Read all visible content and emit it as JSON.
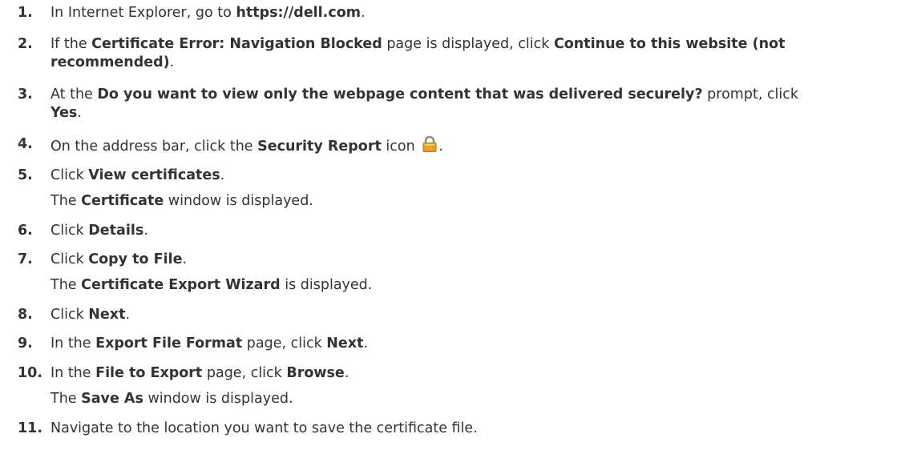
{
  "steps": [
    {
      "num": "1.",
      "parts": [
        {
          "t": "In Internet Explorer, go to ",
          "b": false
        },
        {
          "t": "https://dell.com",
          "b": true
        },
        {
          "t": ".",
          "b": false
        }
      ]
    },
    {
      "num": "2.",
      "parts": [
        {
          "t": "If the ",
          "b": false
        },
        {
          "t": "Certificate Error: Navigation Blocked",
          "b": true
        },
        {
          "t": " page is displayed, click ",
          "b": false
        },
        {
          "t": "Continue to this website (not",
          "b": true
        }
      ],
      "parts2": [
        {
          "t": "recommended)",
          "b": true
        },
        {
          "t": ".",
          "b": false
        }
      ]
    },
    {
      "num": "3.",
      "parts": [
        {
          "t": "At the ",
          "b": false
        },
        {
          "t": "Do you want to view only the webpage content that was delivered securely?",
          "b": true
        },
        {
          "t": " prompt, click",
          "b": false
        }
      ],
      "parts2": [
        {
          "t": "Yes",
          "b": true
        },
        {
          "t": ".",
          "b": false
        }
      ]
    },
    {
      "num": "4.",
      "parts": [
        {
          "t": "On the address bar, click the ",
          "b": false
        },
        {
          "t": "Security Report",
          "b": true
        },
        {
          "t": " icon ",
          "b": false
        }
      ],
      "after_icon": "."
    },
    {
      "num": "5.",
      "parts": [
        {
          "t": "Click ",
          "b": false
        },
        {
          "t": "View certificates",
          "b": true
        },
        {
          "t": ".",
          "b": false
        }
      ],
      "result": [
        {
          "t": "The ",
          "b": false
        },
        {
          "t": "Certificate",
          "b": true
        },
        {
          "t": " window is displayed.",
          "b": false
        }
      ]
    },
    {
      "num": "6.",
      "parts": [
        {
          "t": "Click ",
          "b": false
        },
        {
          "t": "Details",
          "b": true
        },
        {
          "t": ".",
          "b": false
        }
      ]
    },
    {
      "num": "7.",
      "parts": [
        {
          "t": "Click ",
          "b": false
        },
        {
          "t": "Copy to File",
          "b": true
        },
        {
          "t": ".",
          "b": false
        }
      ],
      "result": [
        {
          "t": "The ",
          "b": false
        },
        {
          "t": "Certificate Export Wizard",
          "b": true
        },
        {
          "t": " is displayed.",
          "b": false
        }
      ]
    },
    {
      "num": "8.",
      "parts": [
        {
          "t": "Click ",
          "b": false
        },
        {
          "t": "Next",
          "b": true
        },
        {
          "t": ".",
          "b": false
        }
      ]
    },
    {
      "num": "9.",
      "parts": [
        {
          "t": "In the ",
          "b": false
        },
        {
          "t": "Export File Format",
          "b": true
        },
        {
          "t": " page, click ",
          "b": false
        },
        {
          "t": "Next",
          "b": true
        },
        {
          "t": ".",
          "b": false
        }
      ]
    },
    {
      "num": "10.",
      "parts": [
        {
          "t": "In the ",
          "b": false
        },
        {
          "t": "File to Export",
          "b": true
        },
        {
          "t": " page, click ",
          "b": false
        },
        {
          "t": "Browse",
          "b": true
        },
        {
          "t": ".",
          "b": false
        }
      ],
      "result": [
        {
          "t": "The ",
          "b": false
        },
        {
          "t": "Save As",
          "b": true
        },
        {
          "t": " window is displayed.",
          "b": false
        }
      ]
    },
    {
      "num": "11.",
      "parts": [
        {
          "t": "Navigate to the location you want to save the certificate file.",
          "b": false
        }
      ]
    }
  ],
  "icon": "padlock-icon",
  "colors": {
    "text": "#333333",
    "lock_body": "#e8a21c",
    "lock_shackle": "#8a8a8a"
  }
}
